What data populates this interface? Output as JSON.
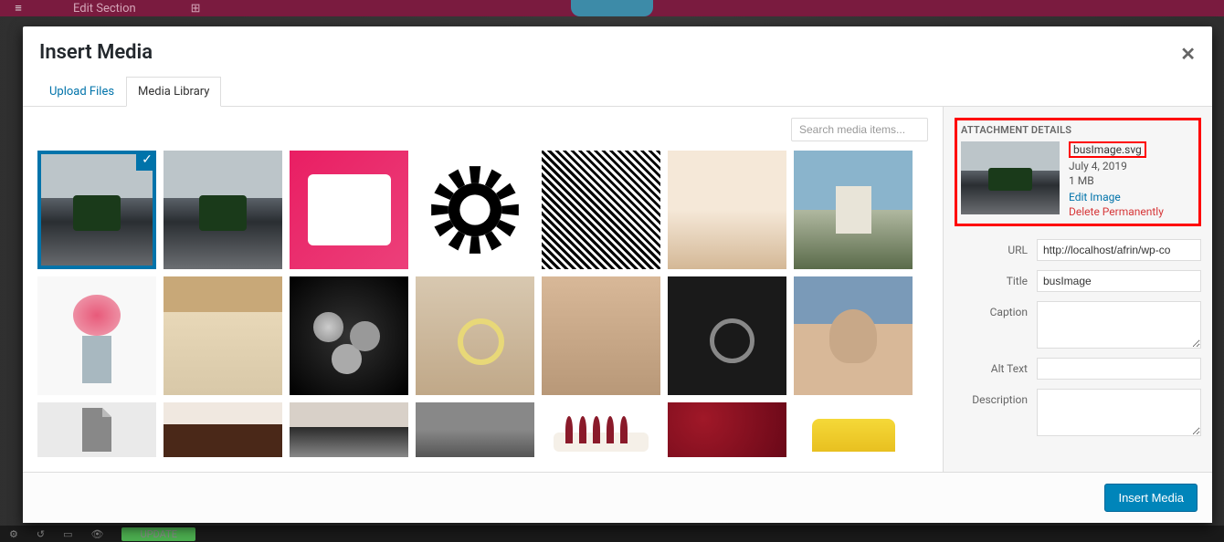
{
  "background": {
    "editSection": "Edit Section",
    "update": "UPDATE"
  },
  "modal": {
    "title": "Insert Media",
    "tabs": {
      "upload": "Upload Files",
      "library": "Media Library"
    },
    "search_placeholder": "Search media items...",
    "insert_button": "Insert Media"
  },
  "attachment": {
    "heading": "ATTACHMENT DETAILS",
    "filename": "busImage.svg",
    "date": "July 4, 2019",
    "size": "1 MB",
    "edit": "Edit Image",
    "delete": "Delete Permanently",
    "fields": {
      "url_label": "URL",
      "url_value": "http://localhost/afrin/wp-co",
      "title_label": "Title",
      "title_value": "busImage",
      "caption_label": "Caption",
      "caption_value": "",
      "alt_label": "Alt Text",
      "alt_value": "",
      "desc_label": "Description",
      "desc_value": ""
    }
  }
}
